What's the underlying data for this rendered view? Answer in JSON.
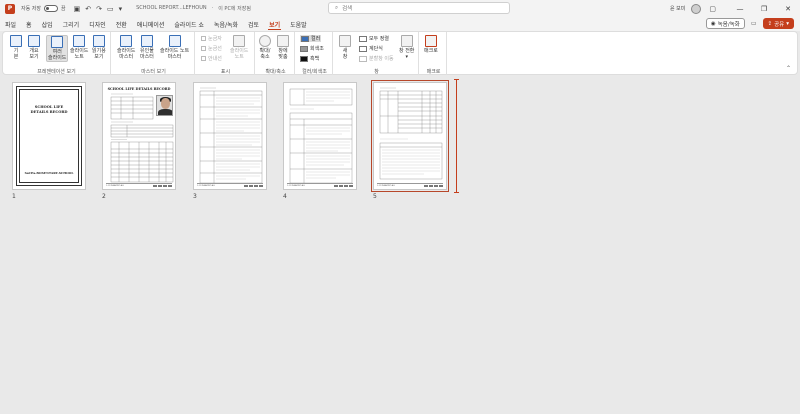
{
  "titlebar": {
    "app_letter": "P",
    "autosave_label": "자동 저장",
    "autosave_state": "끔",
    "doc_name": "SCHOOL REPORT...LEFHOUN",
    "doc_location": "이 PC에 저장됨",
    "search_placeholder": "검색",
    "user_name": "윤 보미"
  },
  "menu": {
    "tabs": [
      "파일",
      "홈",
      "삽입",
      "그리기",
      "디자인",
      "전환",
      "애니메이션",
      "슬라이드 쇼",
      "녹음/녹화",
      "검토",
      "보기",
      "도움말"
    ],
    "active_tab": "보기",
    "record_label": "녹음/녹화",
    "share_label": "공유"
  },
  "ribbon": {
    "groups": {
      "presentation_views": "프레젠테이션 보기",
      "master_views": "마스터 보기",
      "show": "표시",
      "zoom": "확대/축소",
      "color": "컬러/회색조",
      "window": "창",
      "macros": "매크로"
    },
    "buttons": {
      "normal": [
        "기",
        "본"
      ],
      "outline": [
        "개요",
        "보기"
      ],
      "sorter": [
        "여러",
        "슬라이드"
      ],
      "notes_page": [
        "슬라이드",
        "노트"
      ],
      "reading": [
        "읽기용",
        "보기"
      ],
      "slide_master": [
        "슬라이드",
        "마스터"
      ],
      "handout_master": [
        "유인물",
        "마스터"
      ],
      "notes_master": [
        "슬라이드 노트",
        "마스터"
      ],
      "notes": [
        "슬라이드",
        "노트"
      ],
      "zoom": [
        "확대/",
        "축소"
      ],
      "fit": [
        "창에",
        "맞춤"
      ],
      "new_window": [
        "새",
        "창"
      ],
      "switch_window": [
        "창 전환"
      ],
      "macros": [
        "매크로"
      ]
    },
    "show_checks": [
      "눈금자",
      "눈금선",
      "안내선"
    ],
    "color_options": [
      "컬러",
      "회색조",
      "흑백"
    ],
    "window_options": [
      "모두 정렬",
      "계단식",
      "분할창 이동"
    ]
  },
  "slides": [
    {
      "number": "1",
      "title_line1": "SCHOOL LIFE",
      "title_line2": "DETAILS RECORD",
      "school": "SaCPa-BOSENTARY-SCHOOL"
    },
    {
      "number": "2",
      "title": "SCHOOL LIFE DETAILS RECORD",
      "footer": "1-11-THEARTFIT-ALL"
    },
    {
      "number": "3",
      "footer": "1-11-THEARTFIT-ALL"
    },
    {
      "number": "4",
      "footer": "1-11-THEARTFIT-ALL"
    },
    {
      "number": "5",
      "footer": "1-11-THEARTFIT-ALL"
    }
  ],
  "colors": {
    "accent": "#c43e1c",
    "ribbon_icon": "#3a6fb6"
  }
}
